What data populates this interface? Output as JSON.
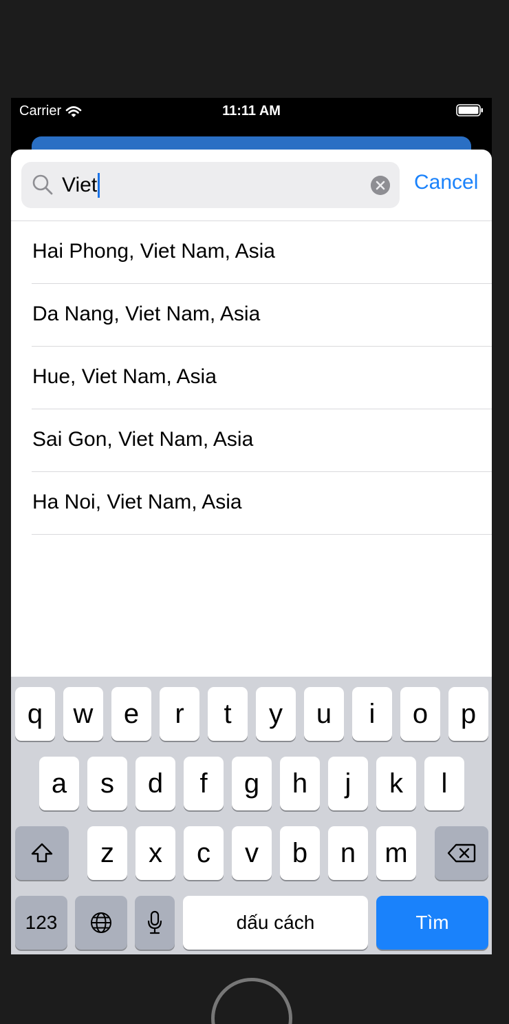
{
  "status_bar": {
    "carrier": "Carrier",
    "time": "11:11 AM"
  },
  "search": {
    "query": "Viet",
    "cancel_label": "Cancel"
  },
  "results": [
    "Hai Phong, Viet Nam, Asia",
    "Da Nang, Viet Nam, Asia",
    "Hue, Viet Nam, Asia",
    "Sai Gon, Viet Nam, Asia",
    "Ha Noi, Viet Nam, Asia"
  ],
  "keyboard": {
    "row1": [
      "q",
      "w",
      "e",
      "r",
      "t",
      "y",
      "u",
      "i",
      "o",
      "p"
    ],
    "row2": [
      "a",
      "s",
      "d",
      "f",
      "g",
      "h",
      "j",
      "k",
      "l"
    ],
    "row3": [
      "z",
      "x",
      "c",
      "v",
      "b",
      "n",
      "m"
    ],
    "numbers_label": "123",
    "space_label": "dấu cách",
    "return_label": "Tìm"
  },
  "colors": {
    "accent": "#1a82fb",
    "sheet": "#ffffff",
    "keyboard_bg": "#d1d3d9"
  }
}
